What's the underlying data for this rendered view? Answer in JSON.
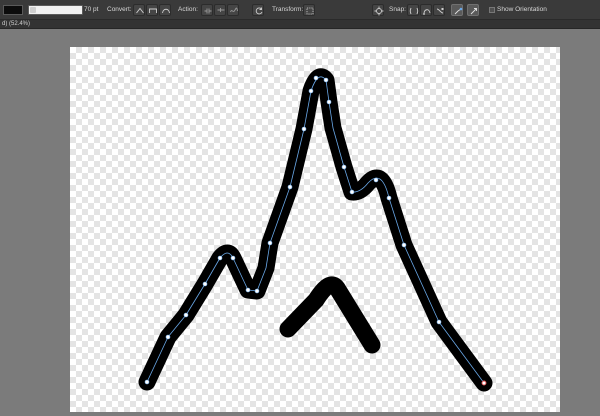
{
  "toolbar": {
    "stroke_color": "#0c0c0c",
    "width_value": "70 pt",
    "convert_label": "Convert:",
    "action_label": "Action:",
    "transform_label": "Transform:",
    "snap_label": "Snap:",
    "show_orientation_label": "Show Orientation",
    "show_orientation_checked": false,
    "icons": [
      "convert-sharp-icon",
      "convert-smooth-icon",
      "convert-smart-icon",
      "break-curve-icon",
      "join-curves-icon",
      "reverse-curve-icon",
      "transform-mode-icon",
      "snap-to-geometry-icon",
      "snap-to-curves-icon",
      "snap-to-nodes-icon",
      "snap-toggle-icon",
      "show-orientation-icon"
    ]
  },
  "document": {
    "title": "d) (52.4%)"
  },
  "canvas": {
    "artboard_background": "transparent-checkerboard",
    "stroke_color": "#000000",
    "path_color": "#6aa8e8",
    "node_color": "#ffffff",
    "end_node_color": "#e05050"
  }
}
